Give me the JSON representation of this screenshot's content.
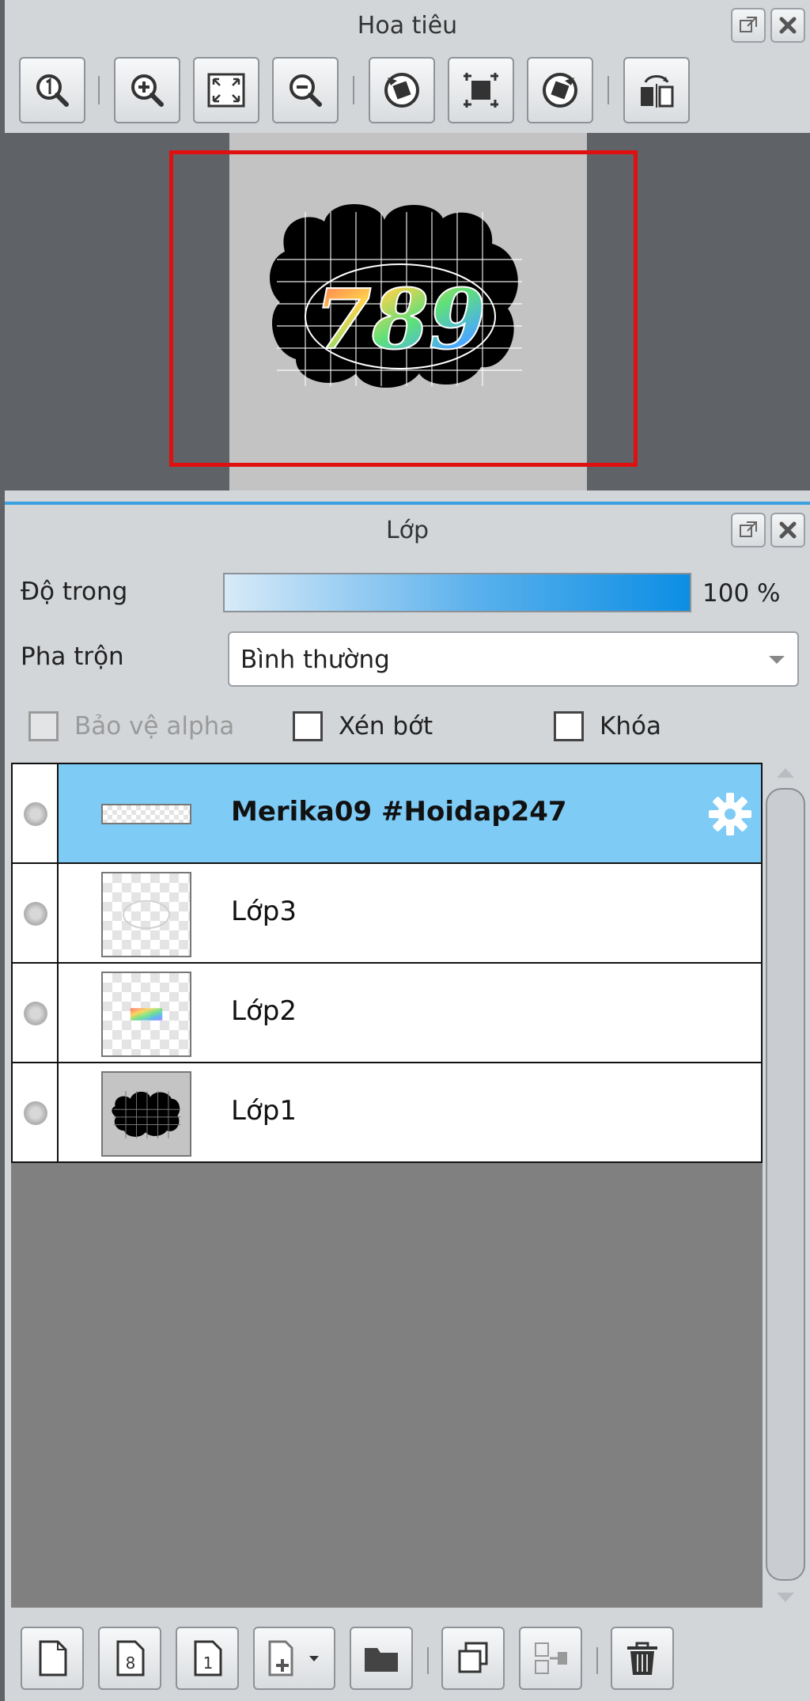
{
  "navigator": {
    "title": "Hoa tiêu",
    "toolbar": [
      {
        "icon": "zoom-actual-size-icon"
      },
      {
        "icon": "zoom-in-icon"
      },
      {
        "icon": "fit-to-window-icon"
      },
      {
        "icon": "zoom-out-icon"
      },
      {
        "icon": "rotate-left-icon"
      },
      {
        "icon": "reset-view-icon"
      },
      {
        "icon": "rotate-right-icon"
      },
      {
        "icon": "flip-horizontal-icon"
      }
    ],
    "preview": {
      "artwork_text": "789",
      "view_frame_color": "#e01010"
    }
  },
  "layers": {
    "title": "Lớp",
    "opacity": {
      "label": "Độ trong",
      "value": "100 %",
      "fraction": 1.0
    },
    "blend": {
      "label": "Pha trộn",
      "value": "Bình thường"
    },
    "checkboxes": {
      "protect_alpha": {
        "label": "Bảo vệ alpha",
        "checked": false,
        "enabled": false
      },
      "clipping": {
        "label": "Xén bớt",
        "checked": false,
        "enabled": true
      },
      "lock": {
        "label": "Khóa",
        "checked": false,
        "enabled": true
      }
    },
    "items": [
      {
        "name": "Merika09 #Hoidap247",
        "selected": true
      },
      {
        "name": "Lớp3",
        "selected": false
      },
      {
        "name": "Lớp2",
        "selected": false
      },
      {
        "name": "Lớp1",
        "selected": false
      }
    ],
    "bottom_toolbar": [
      {
        "icon": "new-layer-icon"
      },
      {
        "icon": "new-8bit-layer-icon"
      },
      {
        "icon": "new-1bit-layer-icon"
      },
      {
        "icon": "add-layer-dropdown-icon"
      },
      {
        "icon": "new-folder-icon"
      },
      {
        "icon": "duplicate-layer-icon"
      },
      {
        "icon": "merge-down-icon"
      },
      {
        "icon": "delete-layer-icon"
      }
    ]
  },
  "colors": {
    "selection": "#7ecbf6",
    "accent": "#3aa0e0",
    "panel_bg": "#d3d6d9"
  }
}
